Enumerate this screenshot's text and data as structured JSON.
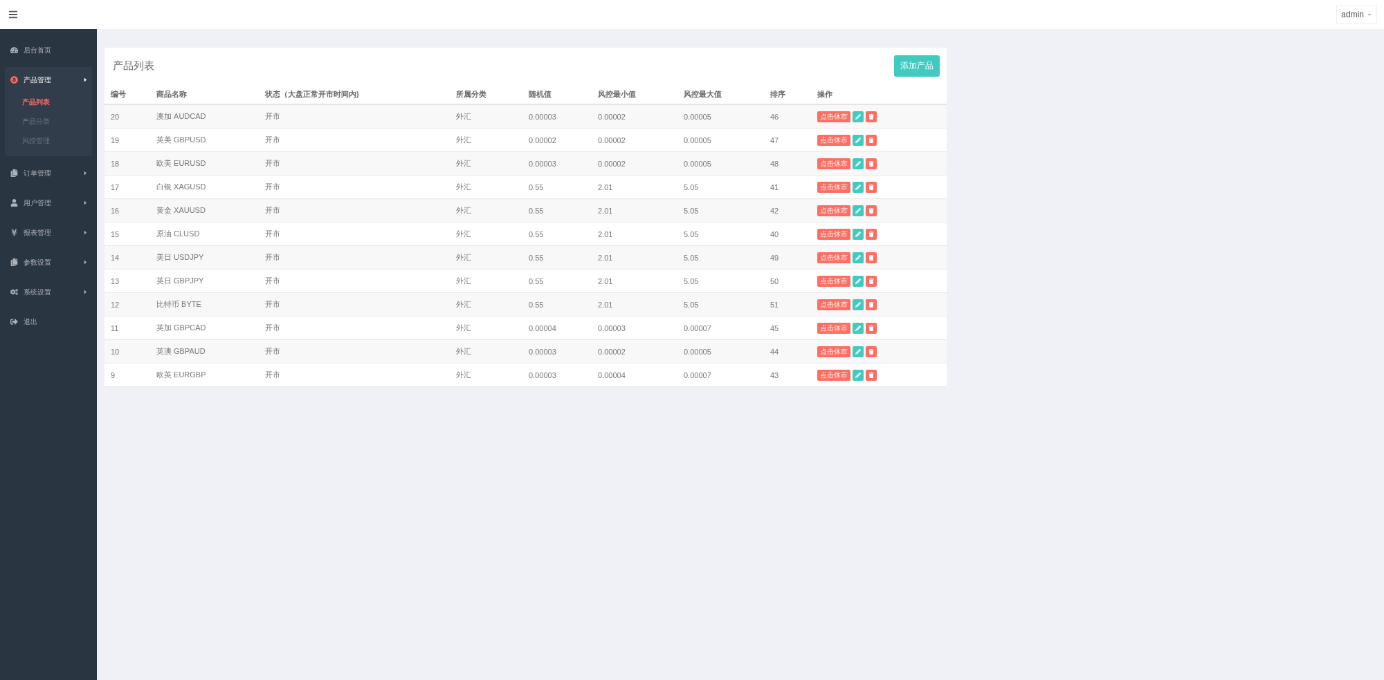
{
  "topbar": {
    "user": "admin"
  },
  "sidebar": {
    "items": [
      {
        "label": "后台首页",
        "selected": false
      },
      {
        "label": "产品管理",
        "selected": true,
        "expanded": true,
        "children": [
          {
            "label": "产品列表",
            "selected": true
          },
          {
            "label": "产品分类",
            "selected": false
          },
          {
            "label": "风控管理",
            "selected": false
          }
        ]
      },
      {
        "label": "订单管理",
        "selected": false,
        "expanded": false
      },
      {
        "label": "用户管理",
        "selected": false,
        "expanded": false
      },
      {
        "label": "报表管理",
        "selected": false,
        "expanded": false
      },
      {
        "label": "参数设置",
        "selected": false,
        "expanded": false
      },
      {
        "label": "系统设置",
        "selected": false,
        "expanded": false
      },
      {
        "label": "退出",
        "selected": false
      }
    ]
  },
  "panel": {
    "title": "产品列表",
    "add_button": "添加产品",
    "table": {
      "columns": [
        "编号",
        "商品名称",
        "状态（大盘正常开市时间内)",
        "所属分类",
        "随机值",
        "风控最小值",
        "风控最大值",
        "排序",
        "操作"
      ],
      "rows": [
        {
          "id": "20",
          "name": "澳加 AUDCAD",
          "status": "开市",
          "category": "外汇",
          "random": "0.00003",
          "min": "0.00002",
          "max": "0.00005",
          "sort": "46",
          "action": "点击休市"
        },
        {
          "id": "19",
          "name": "英美 GBPUSD",
          "status": "开市",
          "category": "外汇",
          "random": "0.00002",
          "min": "0.00002",
          "max": "0.00005",
          "sort": "47",
          "action": "点击休市"
        },
        {
          "id": "18",
          "name": "欧美 EURUSD",
          "status": "开市",
          "category": "外汇",
          "random": "0.00003",
          "min": "0.00002",
          "max": "0.00005",
          "sort": "48",
          "action": "点击休市"
        },
        {
          "id": "17",
          "name": "白银 XAGUSD",
          "status": "开市",
          "category": "外汇",
          "random": "0.55",
          "min": "2.01",
          "max": "5.05",
          "sort": "41",
          "action": "点击休市"
        },
        {
          "id": "16",
          "name": "黄金 XAUUSD",
          "status": "开市",
          "category": "外汇",
          "random": "0.55",
          "min": "2.01",
          "max": "5.05",
          "sort": "42",
          "action": "点击休市"
        },
        {
          "id": "15",
          "name": "原油 CLUSD",
          "status": "开市",
          "category": "外汇",
          "random": "0.55",
          "min": "2.01",
          "max": "5.05",
          "sort": "40",
          "action": "点击休市"
        },
        {
          "id": "14",
          "name": "美日 USDJPY",
          "status": "开市",
          "category": "外汇",
          "random": "0.55",
          "min": "2.01",
          "max": "5.05",
          "sort": "49",
          "action": "点击休市"
        },
        {
          "id": "13",
          "name": "英日 GBPJPY",
          "status": "开市",
          "category": "外汇",
          "random": "0.55",
          "min": "2.01",
          "max": "5.05",
          "sort": "50",
          "action": "点击休市"
        },
        {
          "id": "12",
          "name": "比特币 BYTE",
          "status": "开市",
          "category": "外汇",
          "random": "0.55",
          "min": "2.01",
          "max": "5.05",
          "sort": "51",
          "action": "点击休市"
        },
        {
          "id": "11",
          "name": "英加 GBPCAD",
          "status": "开市",
          "category": "外汇",
          "random": "0.00004",
          "min": "0.00003",
          "max": "0.00007",
          "sort": "45",
          "action": "点击休市"
        },
        {
          "id": "10",
          "name": "英澳 GBPAUD",
          "status": "开市",
          "category": "外汇",
          "random": "0.00003",
          "min": "0.00002",
          "max": "0.00005",
          "sort": "44",
          "action": "点击休市"
        },
        {
          "id": "9",
          "name": "欧英 EURGBP",
          "status": "开市",
          "category": "外汇",
          "random": "0.00003",
          "min": "0.00004",
          "max": "0.00007",
          "sort": "43",
          "action": "点击休市"
        }
      ]
    }
  }
}
